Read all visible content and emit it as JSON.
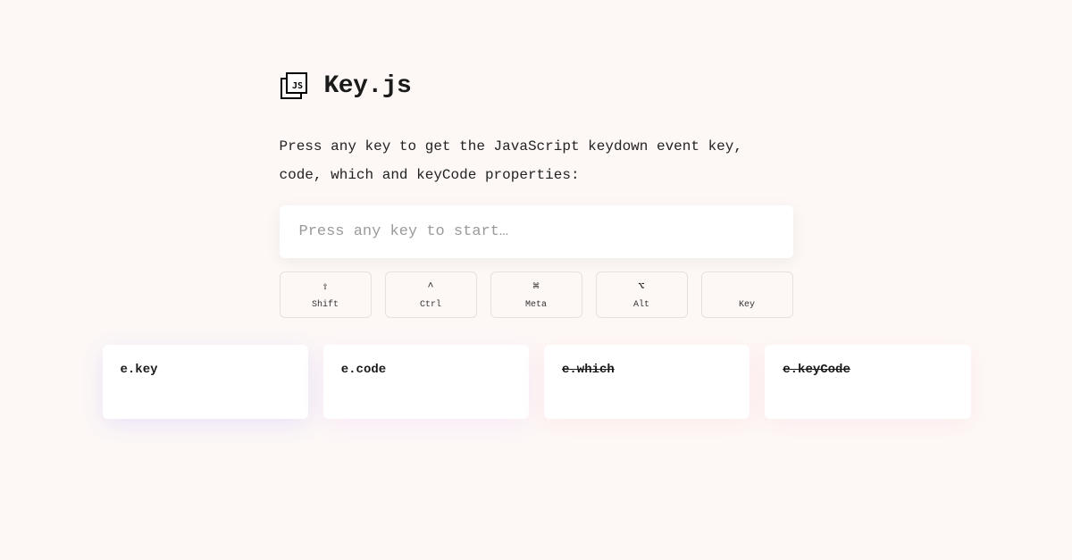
{
  "header": {
    "title": "Key.js"
  },
  "subtitle": "Press any key to get the JavaScript keydown event key, code, which and keyCode properties:",
  "input": {
    "placeholder": "Press any key to start…"
  },
  "modifierKeys": [
    {
      "symbol": "⇧",
      "label": "Shift"
    },
    {
      "symbol": "^",
      "label": "Ctrl"
    },
    {
      "symbol": "⌘",
      "label": "Meta"
    },
    {
      "symbol": "⌥",
      "label": "Alt"
    },
    {
      "symbol": "",
      "label": "Key"
    }
  ],
  "results": [
    {
      "label": "e.key",
      "deprecated": false
    },
    {
      "label": "e.code",
      "deprecated": false
    },
    {
      "label": "e.which",
      "deprecated": true
    },
    {
      "label": "e.keyCode",
      "deprecated": true
    }
  ]
}
